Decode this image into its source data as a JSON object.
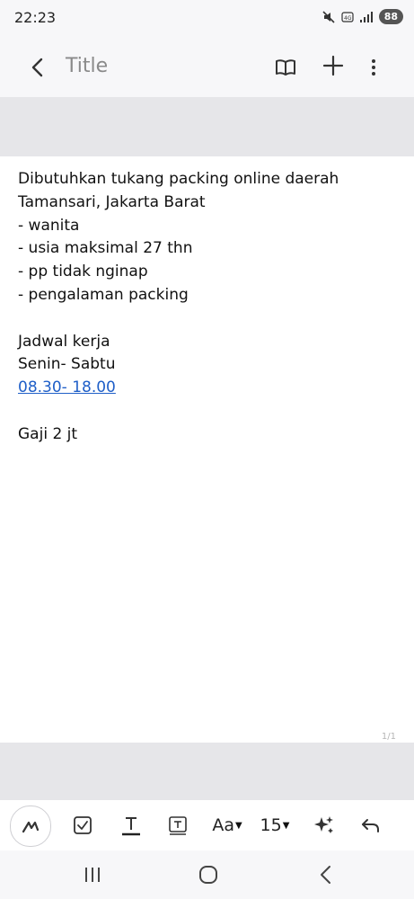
{
  "status": {
    "time": "22:23",
    "battery": "88",
    "icons": [
      "mute-icon",
      "volte-icon",
      "signal-icon",
      "battery-icon"
    ]
  },
  "header": {
    "title": "Title",
    "icons": [
      "back-arrow-icon",
      "reading-mode-icon",
      "plus-icon",
      "more-vert-icon"
    ]
  },
  "note": {
    "lines": [
      "Dibutuhkan tukang packing online daerah",
      "Tamansari, Jakarta Barat",
      "- wanita",
      "- usia maksimal 27 thn",
      "- pp tidak nginap",
      "- pengalaman packing",
      "",
      "Jadwal kerja",
      "Senin- Sabtu",
      "08.30- 18.00",
      "",
      "Gaji 2 jt"
    ],
    "page_indicator": "1/1"
  },
  "toolbar": {
    "font_label": "Aa",
    "size_label": "15",
    "icons": [
      "handwriting-icon",
      "checkbox-icon",
      "text-style-icon",
      "text-box-icon",
      "font-caret-icon",
      "ai-sparkle-icon",
      "undo-icon"
    ]
  },
  "navbar": {
    "icons": [
      "recents-icon",
      "home-icon",
      "back-icon"
    ]
  },
  "colors": {
    "link": "#1f5fc8",
    "band": "#e6e6e9",
    "background": "#f7f7f9"
  }
}
